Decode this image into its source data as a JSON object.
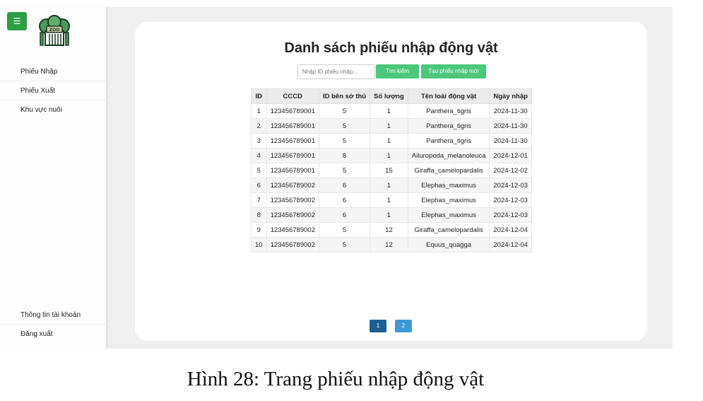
{
  "sidebar": {
    "menu_icon": "hamburger-icon",
    "logo_icon": "zoo-logo-icon",
    "logo_text": "ZOO",
    "items": [
      {
        "label": "Phiếu Nhập"
      },
      {
        "label": "Phiếu Xuất"
      },
      {
        "label": "Khu vực nuôi"
      }
    ],
    "bottom_items": [
      {
        "label": "Thông tin tài khoản"
      },
      {
        "label": "Đăng xuất"
      }
    ]
  },
  "main": {
    "title": "Danh sách phiếu nhập động vật",
    "search": {
      "placeholder": "Nhập ID phiếu nhập...",
      "value": "",
      "search_button": "Tìm kiếm",
      "create_button": "Tạo phiếu nhập mới"
    },
    "table": {
      "headers": [
        "ID",
        "CCCD",
        "ID bên sở thú",
        "Số lượng",
        "Tên loài động vật",
        "Ngày nhập"
      ],
      "rows": [
        [
          "1",
          "123456789001",
          "5",
          "1",
          "Panthera_tigris",
          "2024-11-30"
        ],
        [
          "2",
          "123456789001",
          "5",
          "1",
          "Panthera_tigris",
          "2024-11-30"
        ],
        [
          "3",
          "123456789001",
          "5",
          "1",
          "Panthera_tigris",
          "2024-11-30"
        ],
        [
          "4",
          "123456789001",
          "8",
          "1",
          "Ailuropoda_melanoleuca",
          "2024-12-01"
        ],
        [
          "5",
          "123456789001",
          "5",
          "15",
          "Giraffa_camelopardalis",
          "2024-12-02"
        ],
        [
          "6",
          "123456789002",
          "6",
          "1",
          "Elephas_maximus",
          "2024-12-03"
        ],
        [
          "7",
          "123456789002",
          "6",
          "1",
          "Elephas_maximus",
          "2024-12-03"
        ],
        [
          "8",
          "123456789002",
          "6",
          "1",
          "Elephas_maximus",
          "2024-12-03"
        ],
        [
          "9",
          "123456789002",
          "5",
          "12",
          "Giraffa_camelopardalis",
          "2024-12-04"
        ],
        [
          "10",
          "123456789002",
          "5",
          "12",
          "Equus_quagga",
          "2024-12-04"
        ]
      ]
    },
    "pagination": {
      "pages": [
        "1",
        "2"
      ],
      "current": "1"
    }
  },
  "caption": "Hình 28: Trang phiếu nhập động vật",
  "colors": {
    "menu_button": "#2e9e44",
    "action_button": "#4cc77d",
    "page_active": "#1b5e92",
    "page_inactive": "#3d9ad8"
  }
}
